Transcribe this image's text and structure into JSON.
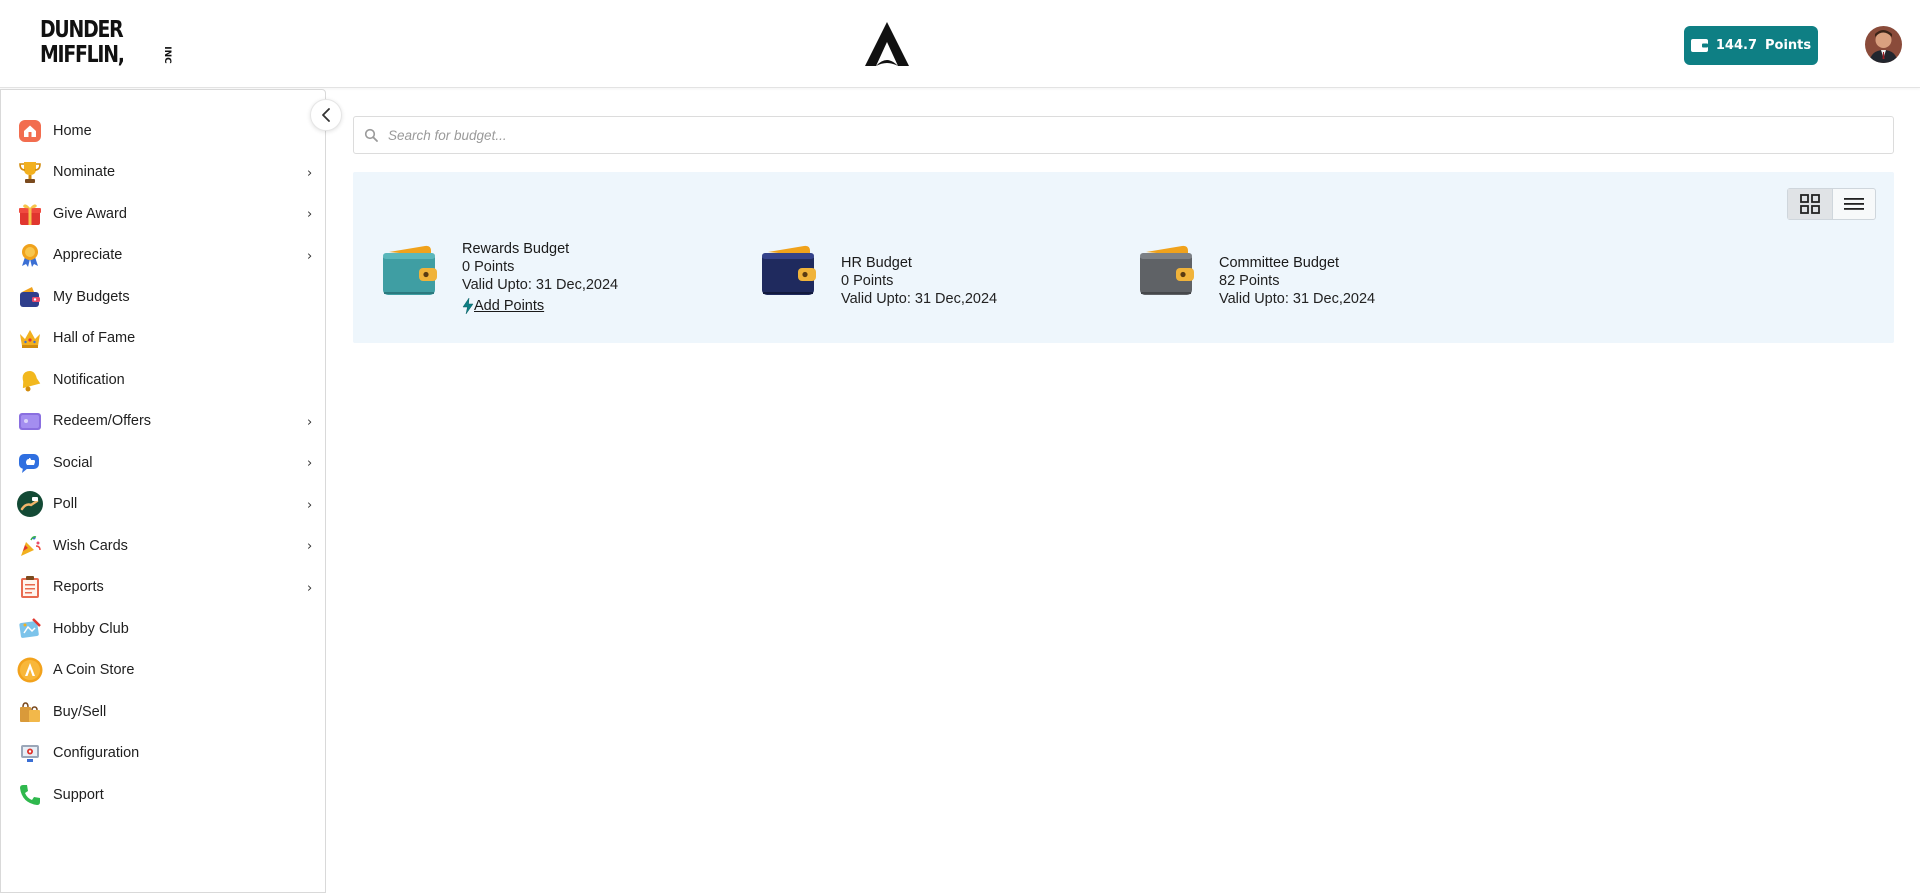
{
  "header": {
    "logo_line1": "DUNDER",
    "logo_line2": "MIFFLIN,",
    "logo_inc": "INC",
    "points_value": "144.7",
    "points_label": "Points"
  },
  "search": {
    "placeholder": "Search for budget..."
  },
  "sidebar": {
    "items": [
      {
        "label": "Home",
        "icon": "home-icon",
        "has_submenu": false
      },
      {
        "label": "Nominate",
        "icon": "trophy-icon",
        "has_submenu": true
      },
      {
        "label": "Give Award",
        "icon": "gift-icon",
        "has_submenu": true
      },
      {
        "label": "Appreciate",
        "icon": "medal-icon",
        "has_submenu": true
      },
      {
        "label": "My Budgets",
        "icon": "wallet-icon",
        "has_submenu": false
      },
      {
        "label": "Hall of Fame",
        "icon": "crown-icon",
        "has_submenu": false
      },
      {
        "label": "Notification",
        "icon": "bell-icon",
        "has_submenu": false
      },
      {
        "label": "Redeem/Offers",
        "icon": "voucher-icon",
        "has_submenu": true
      },
      {
        "label": "Social",
        "icon": "chat-icon",
        "has_submenu": true
      },
      {
        "label": "Poll",
        "icon": "poll-icon",
        "has_submenu": true
      },
      {
        "label": "Wish Cards",
        "icon": "party-popper-icon",
        "has_submenu": true
      },
      {
        "label": "Reports",
        "icon": "clipboard-icon",
        "has_submenu": true
      },
      {
        "label": "Hobby Club",
        "icon": "palette-icon",
        "has_submenu": false
      },
      {
        "label": "A Coin Store",
        "icon": "coin-icon",
        "has_submenu": false
      },
      {
        "label": "Buy/Sell",
        "icon": "shopping-bags-icon",
        "has_submenu": false
      },
      {
        "label": "Configuration",
        "icon": "settings-monitor-icon",
        "has_submenu": false
      },
      {
        "label": "Support",
        "icon": "phone-icon",
        "has_submenu": false
      }
    ]
  },
  "budgets": [
    {
      "name": "Rewards Budget",
      "points": "0 Points",
      "valid": "Valid Upto: 31 Dec,2024",
      "action": "Add Points",
      "color": "#3f9ea3"
    },
    {
      "name": "HR Budget",
      "points": "0 Points",
      "valid": "Valid Upto: 31 Dec,2024",
      "color": "#1f2a5e"
    },
    {
      "name": "Committee Budget",
      "points": "82 Points",
      "valid": "Valid Upto: 31 Dec,2024",
      "color": "#5f6266"
    }
  ],
  "colors": {
    "accent": "#0e7f84",
    "panel_bg": "#eef6fc"
  }
}
